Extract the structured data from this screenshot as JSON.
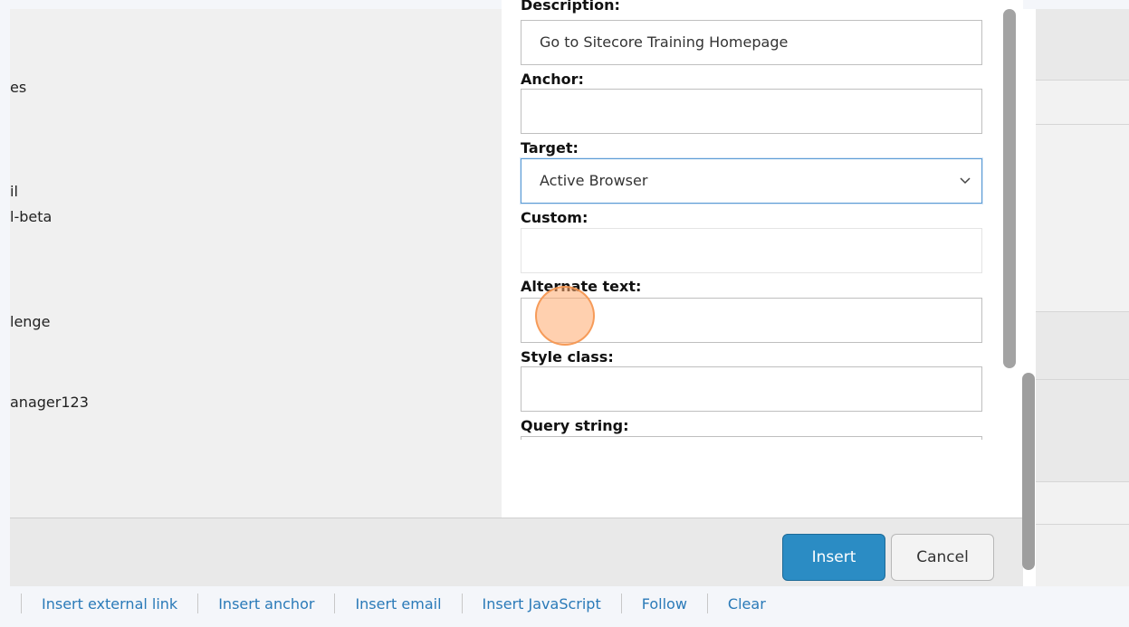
{
  "background": {
    "left_items": [
      "es",
      "il",
      "l-beta",
      "lenge",
      "anager123"
    ]
  },
  "dialog": {
    "description": {
      "label": "Description:",
      "value": "Go to Sitecore Training Homepage"
    },
    "anchor": {
      "label": "Anchor:",
      "value": ""
    },
    "target": {
      "label": "Target:",
      "selected": "Active Browser"
    },
    "custom": {
      "label": "Custom:",
      "value": ""
    },
    "alternate_text": {
      "label": "Alternate text:",
      "value": ""
    },
    "style_class": {
      "label": "Style class:",
      "value": ""
    },
    "query_string": {
      "label": "Query string:",
      "value": ""
    },
    "buttons": {
      "insert": "Insert",
      "cancel": "Cancel"
    }
  },
  "link_bar": {
    "items": [
      "Insert external link",
      "Insert anchor",
      "Insert email",
      "Insert JavaScript",
      "Follow",
      "Clear"
    ]
  },
  "colors": {
    "accent": "#2b8cc4",
    "link": "#2a7ab8",
    "cursor_highlight": "#ffaa6e"
  }
}
